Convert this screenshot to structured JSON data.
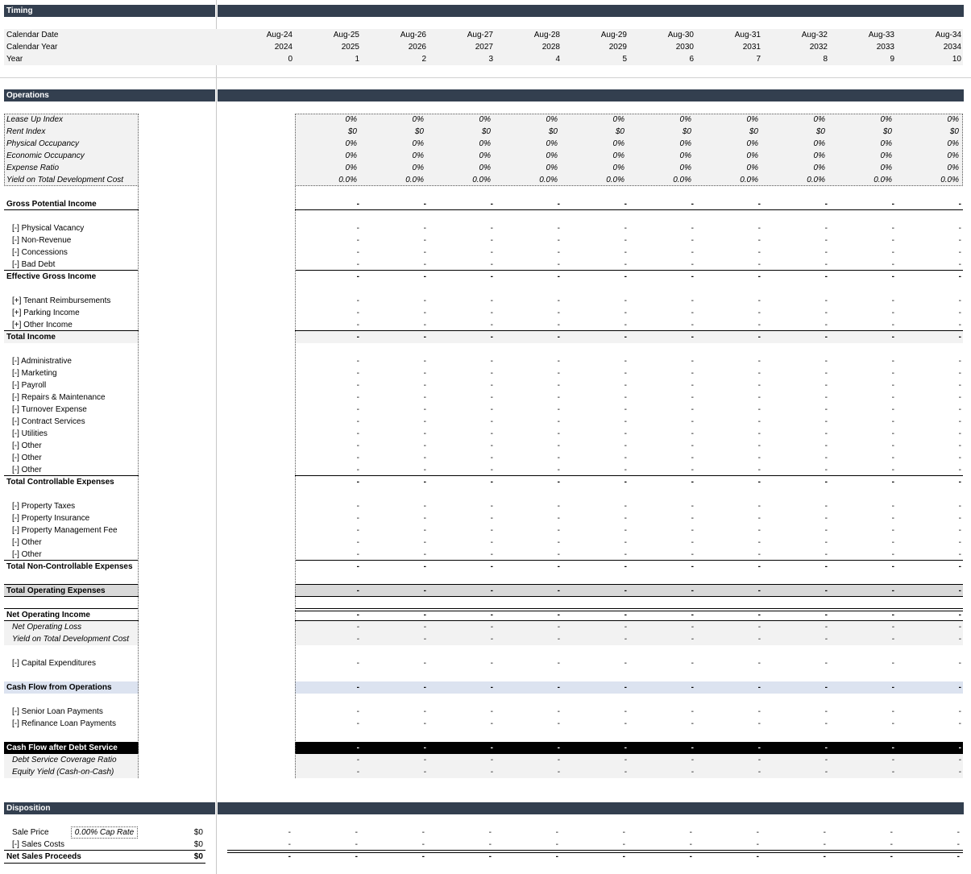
{
  "sections": {
    "timing": "Timing",
    "operations": "Operations",
    "disposition": "Disposition"
  },
  "columns": [
    {
      "date": "Aug-24",
      "year": "2024",
      "idx": "0"
    },
    {
      "date": "Aug-25",
      "year": "2025",
      "idx": "1"
    },
    {
      "date": "Aug-26",
      "year": "2026",
      "idx": "2"
    },
    {
      "date": "Aug-27",
      "year": "2027",
      "idx": "3"
    },
    {
      "date": "Aug-28",
      "year": "2028",
      "idx": "4"
    },
    {
      "date": "Aug-29",
      "year": "2029",
      "idx": "5"
    },
    {
      "date": "Aug-30",
      "year": "2030",
      "idx": "6"
    },
    {
      "date": "Aug-31",
      "year": "2031",
      "idx": "7"
    },
    {
      "date": "Aug-32",
      "year": "2032",
      "idx": "8"
    },
    {
      "date": "Aug-33",
      "year": "2033",
      "idx": "9"
    },
    {
      "date": "Aug-34",
      "year": "2034",
      "idx": "10"
    }
  ],
  "timing_labels": {
    "calendar_date": "Calendar Date",
    "calendar_year": "Calendar Year",
    "year": "Year"
  },
  "indices": [
    {
      "label": "Lease Up Index",
      "value": "0%"
    },
    {
      "label": "Rent Index",
      "value": "$0"
    },
    {
      "label": "Physical Occupancy",
      "value": "0%"
    },
    {
      "label": "Economic Occupancy",
      "value": "0%"
    },
    {
      "label": "Expense Ratio",
      "value": "0%"
    },
    {
      "label": "Yield on Total Development Cost",
      "value": "0.0%"
    }
  ],
  "dash": "-",
  "ops": {
    "gpi": "Gross Potential Income",
    "physical_vacancy": "[-] Physical Vacancy",
    "non_revenue": "[-] Non-Revenue",
    "concessions": "[-] Concessions",
    "bad_debt": "[-] Bad Debt",
    "egi": "Effective Gross Income",
    "tenant_reimb": "[+] Tenant Reimbursements",
    "parking": "[+] Parking Income",
    "other_income": "[+] Other Income",
    "total_income": "Total Income",
    "administrative": "[-] Administrative",
    "marketing": "[-] Marketing",
    "payroll": "[-] Payroll",
    "repairs": "[-] Repairs & Maintenance",
    "turnover": "[-] Turnover Expense",
    "contract": "[-] Contract Services",
    "utilities": "[-] Utilities",
    "other1": "[-] Other",
    "other2": "[-] Other",
    "other3": "[-] Other",
    "total_controllable": "Total Controllable Expenses",
    "property_taxes": "[-] Property Taxes",
    "property_insurance": "[-] Property Insurance",
    "mgmt_fee": "[-] Property Management Fee",
    "other4": "[-] Other",
    "other5": "[-] Other",
    "total_noncontrollable": "Total Non-Controllable Expenses",
    "total_opex": "Total Operating Expenses",
    "noi": "Net Operating Income",
    "nol": "Net Operating Loss",
    "yield_tdc": "Yield on Total Development Cost",
    "capex": "[-] Capital Expenditures",
    "cfo": "Cash Flow from Operations",
    "senior_loan": "[-] Senior Loan Payments",
    "refi_loan": "[-] Refinance Loan Payments",
    "cfads": "Cash Flow after Debt Service",
    "dscr": "Debt Service Coverage Ratio",
    "equity_yield": "Equity Yield (Cash-on-Cash)"
  },
  "disposition": {
    "sale_price": "Sale Price",
    "cap_rate": "0.00% Cap Rate",
    "sale_price_value": "$0",
    "sales_costs": "[-] Sales Costs",
    "sales_costs_value": "$0",
    "net_proceeds": "Net Sales Proceeds",
    "net_proceeds_value": "$0"
  }
}
